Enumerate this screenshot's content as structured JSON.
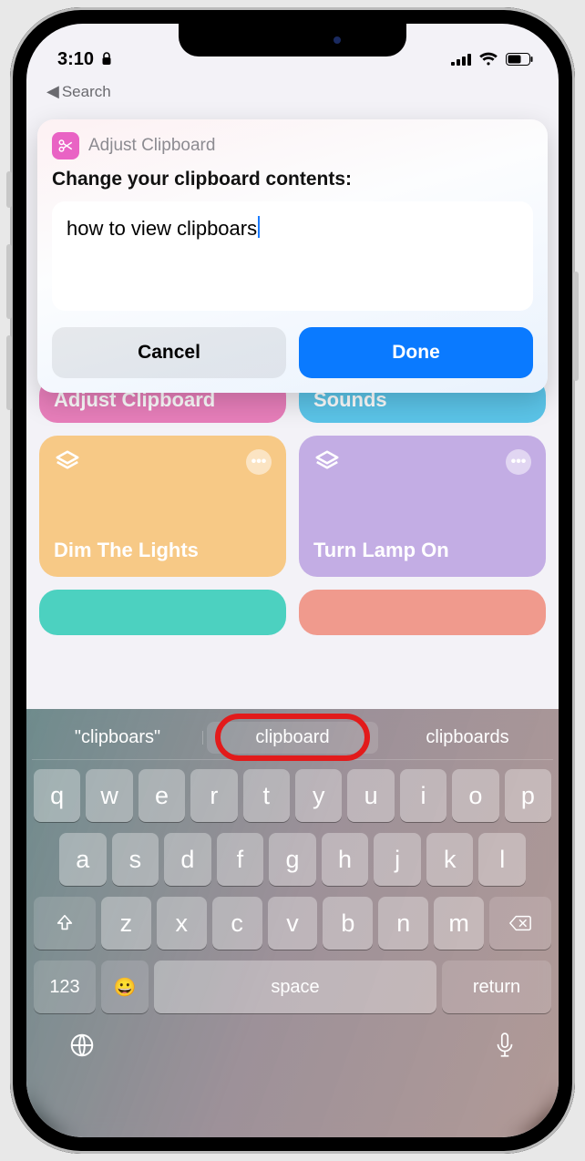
{
  "status": {
    "time": "3:10",
    "portrait_lock_icon": "portrait-lock",
    "signal": 4,
    "wifi": true,
    "battery": 55
  },
  "nav": {
    "back_label": "Search"
  },
  "modal": {
    "app_title": "Adjust Clipboard",
    "prompt": "Change your clipboard contents:",
    "input_value": "how to view clipboars",
    "cancel_label": "Cancel",
    "done_label": "Done",
    "icon_name": "scissors-icon"
  },
  "shortcuts": {
    "row1": [
      {
        "title": "Adjust Clipboard",
        "color": "pink"
      },
      {
        "title": "Sounds",
        "color": "blue"
      }
    ],
    "row2": [
      {
        "title": "Dim The Lights",
        "color": "orange",
        "icon": "stack-icon"
      },
      {
        "title": "Turn Lamp On",
        "color": "purple",
        "icon": "stack-icon"
      }
    ]
  },
  "keyboard": {
    "suggestions": [
      "\"clipboars\"",
      "clipboard",
      "clipboards"
    ],
    "rows": [
      [
        "q",
        "w",
        "e",
        "r",
        "t",
        "y",
        "u",
        "i",
        "o",
        "p"
      ],
      [
        "a",
        "s",
        "d",
        "f",
        "g",
        "h",
        "j",
        "k",
        "l"
      ],
      [
        "z",
        "x",
        "c",
        "v",
        "b",
        "n",
        "m"
      ]
    ],
    "num_key": "123",
    "space_label": "space",
    "return_label": "return"
  }
}
